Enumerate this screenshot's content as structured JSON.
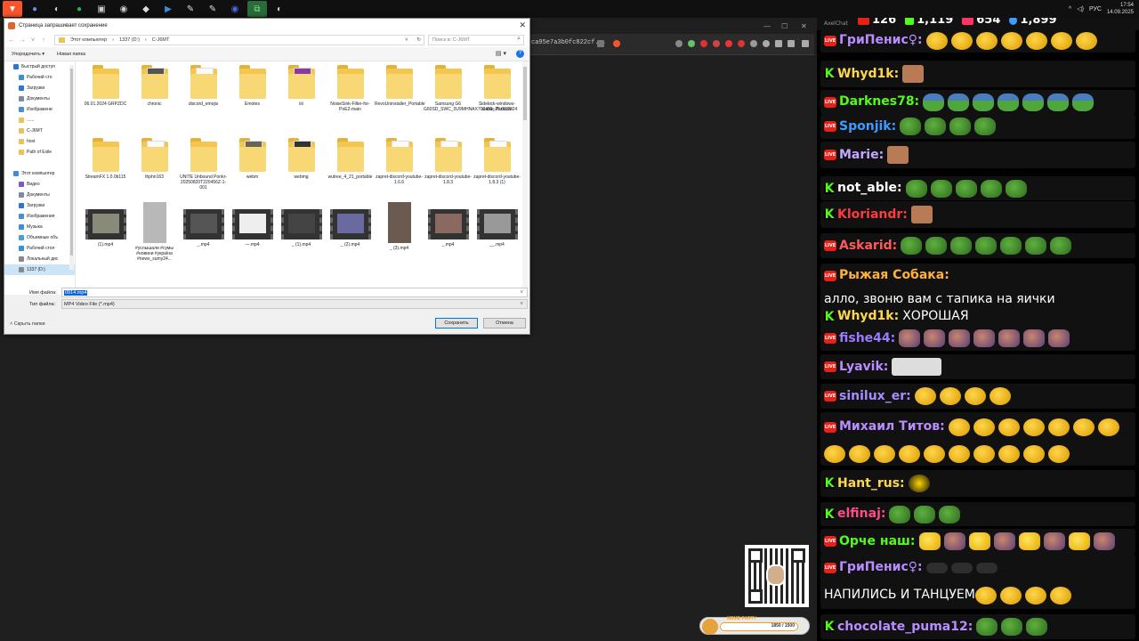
{
  "taskbar": {
    "icons": [
      "brave-icon",
      "discord-icon",
      "steam-icon",
      "spotify-icon",
      "app-icon",
      "obs-icon",
      "roblox-icon",
      "media-icon",
      "app2-icon",
      "app3-icon",
      "active-app-icon",
      "steam2-icon"
    ],
    "lang": "РУС",
    "time": "17:54",
    "date": "14.09.2025"
  },
  "browser_bg": {
    "url": "ca95e7a3b0fc822cf..."
  },
  "dialog": {
    "title": "Страница запрашивает сохранение",
    "breadcrumb": [
      "Этот компьютер",
      "1337 (D:)",
      "C-J6MT"
    ],
    "search_placeholder": "Поиск в: C-J6MT",
    "toolbar": {
      "organize": "Упорядочить ▾",
      "new_folder": "Новая папка"
    },
    "nav": [
      {
        "label": "Быстрый доступ",
        "top": true,
        "color": "#2b77d4"
      },
      {
        "label": "Рабочий сто",
        "color": "#3a8fdc"
      },
      {
        "label": "Загрузки",
        "color": "#2b77d4"
      },
      {
        "label": "Документы",
        "color": "#7a8ca0"
      },
      {
        "label": "Изображени",
        "color": "#4a90d0"
      },
      {
        "label": "......",
        "color": "#e8c25a"
      },
      {
        "label": "C-J6MT",
        "color": "#e8c25a"
      },
      {
        "label": "host",
        "color": "#e8c25a"
      },
      {
        "label": "Path of Exile",
        "color": "#e8c25a"
      },
      {
        "label": "",
        "color": "transparent"
      },
      {
        "label": "Этот компьютер",
        "top": true,
        "color": "#3a8fdc"
      },
      {
        "label": "Видео",
        "color": "#7a5ac8"
      },
      {
        "label": "Документы",
        "color": "#7a8ca0"
      },
      {
        "label": "Загрузки",
        "color": "#2b77d4"
      },
      {
        "label": "Изображения",
        "color": "#4a90d0"
      },
      {
        "label": "Музыка",
        "color": "#3a8fdc"
      },
      {
        "label": "Объемные объ",
        "color": "#4aa0d0"
      },
      {
        "label": "Рабочий стол",
        "color": "#3a8fdc"
      },
      {
        "label": "Локальный дис",
        "color": "#888"
      },
      {
        "label": "1337 (D:)",
        "color": "#888",
        "sel": true
      }
    ],
    "files": [
      {
        "name": "06.01.2024 GRPZDC",
        "type": "folder"
      },
      {
        "name": "chronic",
        "type": "folder-img",
        "img": "#555"
      },
      {
        "name": "discord_emojis",
        "type": "folder-doc"
      },
      {
        "name": "Emotes",
        "type": "folder"
      },
      {
        "name": "iiii",
        "type": "folder-img",
        "img": "#8a3aa0"
      },
      {
        "name": "NoiseSink-Filter-for-PoE2-main",
        "type": "folder"
      },
      {
        "name": "RevoUninstaller_Portable",
        "type": "folder"
      },
      {
        "name": "Samsung G6 G60SD_SWC_0U9MHNAX700491_25.09.2024",
        "type": "folder"
      },
      {
        "name": "Sidekick-windows-stable-Portable",
        "type": "folder"
      },
      {
        "name": "StreamFX 1.0.0b115",
        "type": "folder"
      },
      {
        "name": "thphn163",
        "type": "folder-doc"
      },
      {
        "name": "UNITE Unbound Ponkr-20250820T220456Z-1-001",
        "type": "folder"
      },
      {
        "name": "webm",
        "type": "folder-img",
        "img": "#665"
      },
      {
        "name": "webmg",
        "type": "folder-img",
        "img": "#333"
      },
      {
        "name": "wutree_4_21_portable",
        "type": "folder"
      },
      {
        "name": "zapret-discord-youtube-1.6.6",
        "type": "folder-doc"
      },
      {
        "name": "zapret-discord-youtube-1.8.3",
        "type": "folder-doc"
      },
      {
        "name": "zapret-discord-youtube-1.8.3 (1)",
        "type": "folder-doc"
      },
      {
        "name": "(1).mp4",
        "type": "video",
        "img": "#8a8a7a"
      },
      {
        "name": "#услышали #сумы #новини #україна #news_sumy24...",
        "type": "tall",
        "img": "#b8b8b8"
      },
      {
        "name": "_.mp4",
        "type": "video",
        "img": "#555"
      },
      {
        "name": "—.mp4",
        "type": "video",
        "img": "#eee"
      },
      {
        "name": "_ (1).mp4",
        "type": "video",
        "img": "#444"
      },
      {
        "name": "_ (2).mp4",
        "type": "video",
        "img": "#6a6aa0"
      },
      {
        "name": "_ (3).mp4",
        "type": "tall",
        "img": "#6a5a50"
      },
      {
        "name": "_.mp4",
        "type": "video",
        "img": "#8a6a60"
      },
      {
        "name": "__.mp4",
        "type": "video",
        "img": "#999"
      }
    ],
    "filename_label": "Имя файла:",
    "filename_value": "0914.mp4",
    "filetype_label": "Тип файла:",
    "filetype_value": "MP4 Video File (*.mp4)",
    "hide_folders": "Скрыть папки",
    "save_label": "Сохранить",
    "cancel_label": "Отмена"
  },
  "donation": {
    "title": "MEME PARTY",
    "count": "1850 / 1500"
  },
  "chat": {
    "app_name": "AxelChat",
    "stats": {
      "youtube": "126",
      "kick": "1,119",
      "vk": "654",
      "viewers": "1,899"
    },
    "messages": [
      {
        "platform": "yt",
        "user": "ГриПенис♀:",
        "color": "#b98cff",
        "text": "",
        "emotes": [
          "gold",
          "gold",
          "gold",
          "gold",
          "gold",
          "gold",
          "gold"
        ]
      },
      {
        "platform": "k",
        "user": "Whyd1k:",
        "color": "#ffd84a",
        "text": "",
        "emotes": [
          "face"
        ]
      },
      {
        "platform": "yt",
        "user": "Darknes78:",
        "color": "#53fc18",
        "text": "",
        "emotes": [
          "pepehat",
          "pepehat",
          "pepehat",
          "pepehat",
          "pepehat",
          "pepehat",
          "pepehat"
        ]
      },
      {
        "platform": "yt",
        "user": "Sponjik:",
        "color": "#3d9cff",
        "text": "",
        "emotes": [
          "pepe",
          "pepe",
          "pepe",
          "pepe"
        ]
      },
      {
        "platform": "yt",
        "user": "Marie:",
        "color": "#c4a7ff",
        "text": "",
        "emotes": [
          "face"
        ]
      },
      {
        "platform": "k",
        "user": "not_able:",
        "color": "#ffffff",
        "text": "",
        "emotes": [
          "pepe",
          "pepe",
          "pepe",
          "pepe",
          "pepe"
        ]
      },
      {
        "platform": "k",
        "user": "Kloriandr:",
        "color": "#ff3b3b",
        "text": "",
        "emotes": [
          "face"
        ]
      },
      {
        "platform": "yt",
        "user": "Askarid:",
        "color": "#ff5a5a",
        "text": "",
        "emotes": [
          "pepe",
          "pepe",
          "pepe",
          "pepe",
          "pepe",
          "pepe",
          "pepe"
        ]
      },
      {
        "platform": "yt",
        "user": "Рыжая Собака:",
        "color": "#ffb13b",
        "text": "алло, звоню вам с тапика на яички",
        "emotes": []
      },
      {
        "platform": "k",
        "user": "Whyd1k:",
        "color": "#ffd84a",
        "text": "ХОРОШАЯ",
        "emotes": []
      },
      {
        "platform": "yt",
        "user": "fishe44:",
        "color": "#9b7bff",
        "text": "",
        "emotes": [
          "pixel",
          "pixel",
          "pixel",
          "pixel",
          "pixel",
          "pixel",
          "pixel"
        ]
      },
      {
        "platform": "yt",
        "user": "Lyavik:",
        "color": "#b98cff",
        "text": "",
        "emotes": [
          "blur"
        ]
      },
      {
        "platform": "yt",
        "user": "sinilux_er:",
        "color": "#a88cff",
        "text": "",
        "emotes": [
          "gold",
          "gold",
          "gold",
          "gold"
        ]
      },
      {
        "platform": "yt",
        "user": "Михаил Титов:",
        "color": "#b98cff",
        "text": "",
        "emotes": [
          "gold",
          "gold",
          "gold",
          "gold",
          "gold",
          "gold",
          "gold",
          "gold",
          "gold",
          "gold",
          "gold",
          "gold",
          "gold",
          "gold",
          "gold",
          "gold",
          "gold"
        ]
      },
      {
        "platform": "k",
        "user": "Hant_rus:",
        "color": "#ffd84a",
        "text": "",
        "emotes": [
          "yellowbee"
        ]
      },
      {
        "platform": "k",
        "user": "elfinaj:",
        "color": "#ff4a8a",
        "text": "",
        "emotes": [
          "pepe",
          "pepe",
          "pepe"
        ]
      },
      {
        "platform": "yt",
        "user": "Орче наш:",
        "color": "#53fc18",
        "text": "",
        "emotes": [
          "laugh",
          "pixel",
          "laugh",
          "pixel",
          "laugh",
          "pixel",
          "laugh",
          "pixel"
        ]
      },
      {
        "platform": "yt",
        "user": "ГриПенис♀:",
        "color": "#b98cff",
        "text": "НАПИЛИСЬ И ТАНЦУЕМ",
        "emotes": [
          "mask",
          "mask",
          "mask"
        ],
        "trail": [
          "gold",
          "gold",
          "gold",
          "gold"
        ]
      },
      {
        "platform": "k",
        "user": "chocolate_puma12:",
        "color": "#b98cff",
        "text": "",
        "emotes": [
          "pepe",
          "pepe",
          "pepe"
        ]
      }
    ]
  }
}
